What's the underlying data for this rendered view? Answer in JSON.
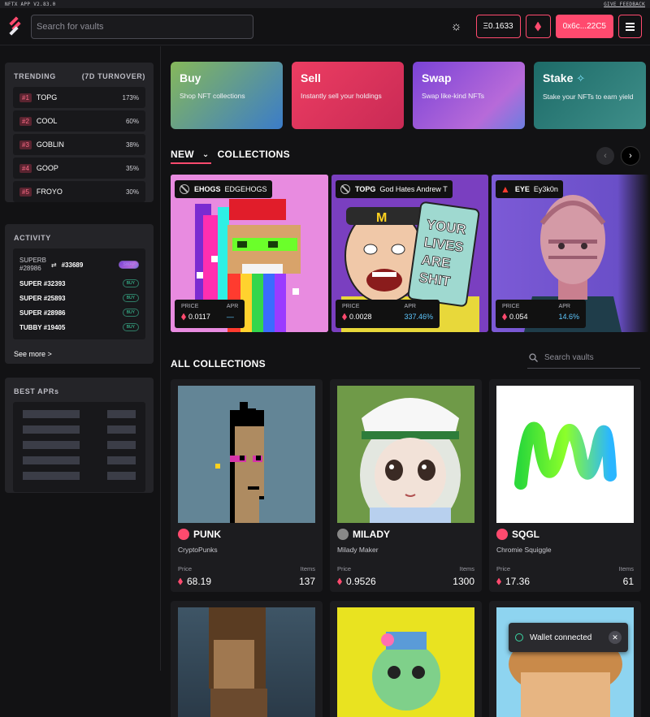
{
  "topbar": {
    "version": "NFTX APP V2.83.0",
    "feedback": "GIVE FEEDBACK"
  },
  "header": {
    "search_placeholder": "Search for vaults",
    "balance": "Ξ0.1633",
    "wallet": "0x6c...22C5",
    "icons": {
      "theme": "sun-icon",
      "network": "ethereum-icon",
      "menu": "menu-icon"
    }
  },
  "sidebar": {
    "trending": {
      "title": "TRENDING",
      "subtitle": "(7D TURNOVER)",
      "items": [
        {
          "rank": "#1",
          "name": "TOPG",
          "pct": "173%"
        },
        {
          "rank": "#2",
          "name": "COOL",
          "pct": "60%"
        },
        {
          "rank": "#3",
          "name": "GOBLIN",
          "pct": "38%"
        },
        {
          "rank": "#4",
          "name": "GOOP",
          "pct": "35%"
        },
        {
          "rank": "#5",
          "name": "FROYO",
          "pct": "30%"
        }
      ]
    },
    "activity": {
      "title": "ACTIVITY",
      "swap": {
        "from_name": "SUPERB",
        "from_id": "#28986",
        "to": "#33689",
        "badge": "SWAP"
      },
      "items": [
        {
          "label": "SUPER #32393",
          "badge": "BUY"
        },
        {
          "label": "SUPER #25893",
          "badge": "BUY"
        },
        {
          "label": "SUPER #28986",
          "badge": "BUY"
        },
        {
          "label": "TUBBY #19405",
          "badge": "BUY"
        }
      ],
      "see_more": "See more >"
    },
    "best_aprs": {
      "title": "BEST APRs"
    }
  },
  "actions": [
    {
      "title": "Buy",
      "desc": "Shop NFT collections"
    },
    {
      "title": "Sell",
      "desc": "Instantly sell your holdings"
    },
    {
      "title": "Swap",
      "desc": "Swap like-kind NFTs"
    },
    {
      "title": "Stake",
      "desc": "Stake your NFTs to earn yield"
    }
  ],
  "new_collections": {
    "new_label": "NEW",
    "collections_label": "COLLECTIONS",
    "featured": [
      {
        "ticker": "EHOGS",
        "name": "EDGEHOGS",
        "price_label": "PRICE",
        "price": "0.0117",
        "apr_label": "APR",
        "apr": "—"
      },
      {
        "ticker": "TOPG",
        "name": "God Hates Andrew T",
        "price_label": "PRICE",
        "price": "0.0028",
        "apr_label": "APR",
        "apr": "337.46%"
      },
      {
        "ticker": "EYE",
        "name": "Ey3k0n",
        "price_label": "PRICE",
        "price": "0.054",
        "apr_label": "APR",
        "apr": "14.6%"
      }
    ],
    "poster_text": "YOUR LIVES ARE SHIT"
  },
  "all_collections": {
    "title": "ALL COLLECTIONS",
    "search_placeholder": "Search vaults",
    "items": [
      {
        "ticker": "PUNK",
        "name": "CryptoPunks",
        "price_label": "Price",
        "price": "68.19",
        "items_label": "Items",
        "items": "137"
      },
      {
        "ticker": "MILADY",
        "name": "Milady Maker",
        "price_label": "Price",
        "price": "0.9526",
        "items_label": "Items",
        "items": "1300"
      },
      {
        "ticker": "SQGL",
        "name": "Chromie Squiggle",
        "price_label": "Price",
        "price": "17.36",
        "items_label": "Items",
        "items": "61"
      }
    ]
  },
  "toast": {
    "text": "Wallet connected"
  }
}
